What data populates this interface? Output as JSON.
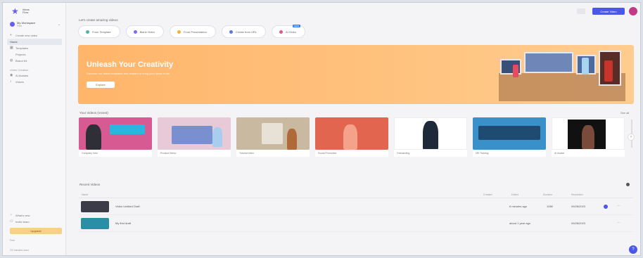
{
  "app": {
    "logo_text": "Ideas Flow"
  },
  "sidebar": {
    "workspace_name": "My Workspace",
    "workspace_sub": "Free",
    "items": [
      {
        "label": "Create new video",
        "icon": "plus-icon",
        "active": false
      },
      {
        "label": "Home",
        "icon": "home-icon",
        "active": true
      },
      {
        "label": "Templates",
        "icon": "grid-icon",
        "active": false
      },
      {
        "label": "Projects",
        "icon": "folder-icon",
        "active": false
      },
      {
        "label": "Brand Kit",
        "icon": "palette-icon",
        "active": false
      }
    ],
    "section_label": "Video Creation",
    "section_items": [
      {
        "label": "AI Avatars",
        "icon": "person-icon"
      },
      {
        "label": "Voices",
        "icon": "mic-icon"
      }
    ],
    "bottom_items": [
      {
        "label": "What's new",
        "icon": "bell-icon"
      },
      {
        "label": "Invite team",
        "icon": "users-icon"
      }
    ],
    "upgrade_label": "Upgrade",
    "foot_top": "Free",
    "foot_bottom": "2/3 minutes used"
  },
  "topbar": {
    "create_label": "Create Video"
  },
  "create": {
    "title": "Let's create amazing videos",
    "pills": [
      {
        "label": "From Template",
        "color": "#4fb6a6"
      },
      {
        "label": "Blank Video",
        "color": "#7c6cf0"
      },
      {
        "label": "From Presentation",
        "color": "#f2b233"
      },
      {
        "label": "Create from URL",
        "color": "#5a7bd8"
      },
      {
        "label": "AI Video",
        "color": "#e05a8a",
        "badge": "NEW"
      }
    ]
  },
  "banner": {
    "title": "Unleash Your Creativity",
    "subtitle": "Discover our latest templates and avatars to bring your ideas to life.",
    "button": "Explore"
  },
  "your_videos": {
    "title": "Your Videos (recent)",
    "see_all": "See all",
    "items": [
      {
        "caption": "Company Intro",
        "bg": "#d85a93",
        "accent": "#2bb6e0"
      },
      {
        "caption": "Product Demo",
        "bg": "#e8c9d8",
        "accent": "#7a8fcf"
      },
      {
        "caption": "Tutorial video",
        "bg": "#c8b9a0",
        "accent": "#e8e2d6"
      },
      {
        "caption": "Social Promotion",
        "bg": "#e2664f",
        "accent": "#f4a38a"
      },
      {
        "caption": "Onboarding",
        "bg": "#ffffff",
        "accent": "#1e2a3a"
      },
      {
        "caption": "HR Training",
        "bg": "#3a90c8",
        "accent": "#1f4b72"
      },
      {
        "caption": "AI Avatar",
        "bg": "#ffffff",
        "accent": "#111111"
      }
    ]
  },
  "recent": {
    "title": "Recent Videos",
    "columns": [
      "Name",
      "Created",
      "Edited",
      "Duration",
      "Resolution"
    ],
    "rows": [
      {
        "name": "Video Untitled Draft",
        "edited": "6 minutes ago",
        "res": "1080",
        "date": "09/28/2023",
        "thumb": "#3c3c48"
      },
      {
        "name": "My first draft",
        "edited": "about 1 year ago",
        "res": "",
        "date": "09/28/2023",
        "thumb": "#2a8fa6"
      }
    ]
  }
}
